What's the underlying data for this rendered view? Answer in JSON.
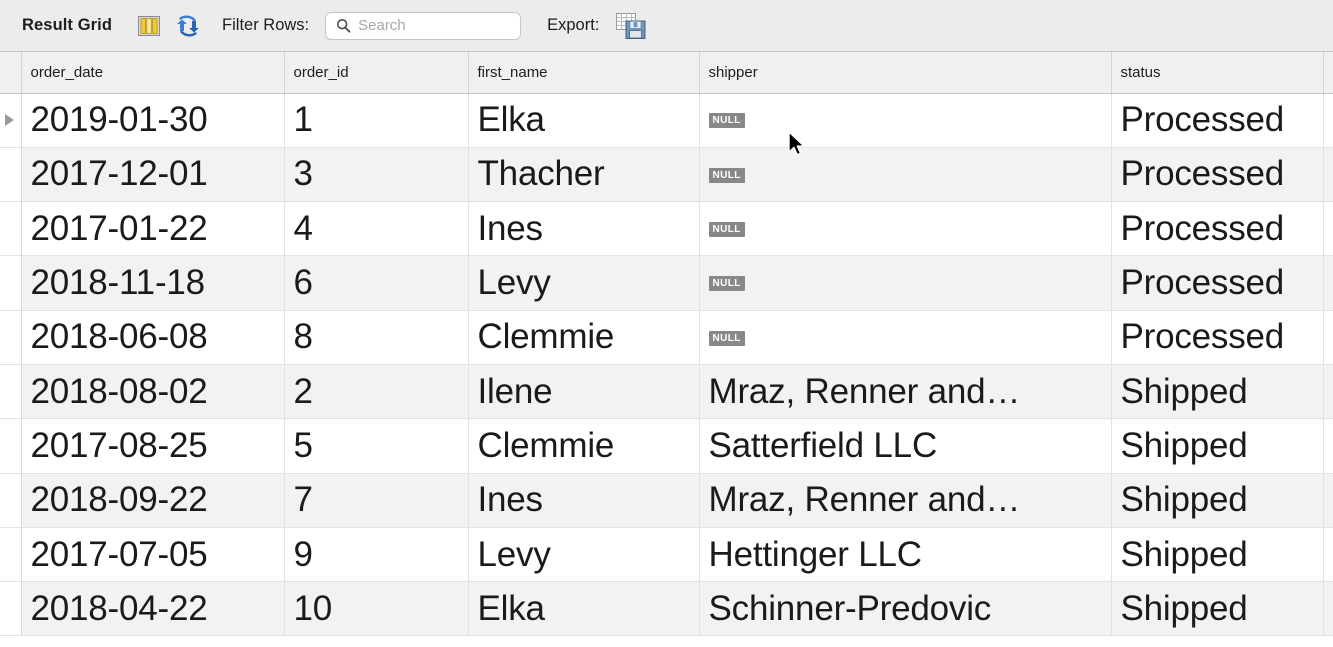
{
  "toolbar": {
    "title": "Result Grid",
    "grid_icon": "grid-icon",
    "refresh_icon": "refresh-icon",
    "filter_label": "Filter Rows:",
    "search_value": "",
    "search_placeholder": "Search",
    "search_icon": "search-icon",
    "export_label": "Export:",
    "export_icon": "export-icon"
  },
  "grid": {
    "columns": [
      {
        "key": "order_date",
        "label": "order_date"
      },
      {
        "key": "order_id",
        "label": "order_id"
      },
      {
        "key": "first_name",
        "label": "first_name"
      },
      {
        "key": "shipper",
        "label": "shipper"
      },
      {
        "key": "status",
        "label": "status"
      }
    ],
    "null_label": "NULL",
    "selected_row_index": 0,
    "rows": [
      {
        "order_date": "2019-01-30",
        "order_id": "1",
        "first_name": "Elka",
        "shipper": null,
        "status": "Processed"
      },
      {
        "order_date": "2017-12-01",
        "order_id": "3",
        "first_name": "Thacher",
        "shipper": null,
        "status": "Processed"
      },
      {
        "order_date": "2017-01-22",
        "order_id": "4",
        "first_name": "Ines",
        "shipper": null,
        "status": "Processed"
      },
      {
        "order_date": "2018-11-18",
        "order_id": "6",
        "first_name": "Levy",
        "shipper": null,
        "status": "Processed"
      },
      {
        "order_date": "2018-06-08",
        "order_id": "8",
        "first_name": "Clemmie",
        "shipper": null,
        "status": "Processed"
      },
      {
        "order_date": "2018-08-02",
        "order_id": "2",
        "first_name": "Ilene",
        "shipper": "Mraz, Renner and…",
        "status": "Shipped"
      },
      {
        "order_date": "2017-08-25",
        "order_id": "5",
        "first_name": "Clemmie",
        "shipper": "Satterfield LLC",
        "status": "Shipped"
      },
      {
        "order_date": "2018-09-22",
        "order_id": "7",
        "first_name": "Ines",
        "shipper": "Mraz, Renner and…",
        "status": "Shipped"
      },
      {
        "order_date": "2017-07-05",
        "order_id": "9",
        "first_name": "Levy",
        "shipper": "Hettinger LLC",
        "status": "Shipped"
      },
      {
        "order_date": "2018-04-22",
        "order_id": "10",
        "first_name": "Elka",
        "shipper": "Schinner-Predovic",
        "status": "Shipped"
      }
    ]
  },
  "colors": {
    "toolbar_bg": "#ececec",
    "header_bg": "#f0f0f0",
    "row_alt_bg": "#f2f2f2",
    "null_badge_bg": "#888888",
    "accent_blue": "#3b7dd8",
    "icon_yellow": "#f2c832"
  }
}
